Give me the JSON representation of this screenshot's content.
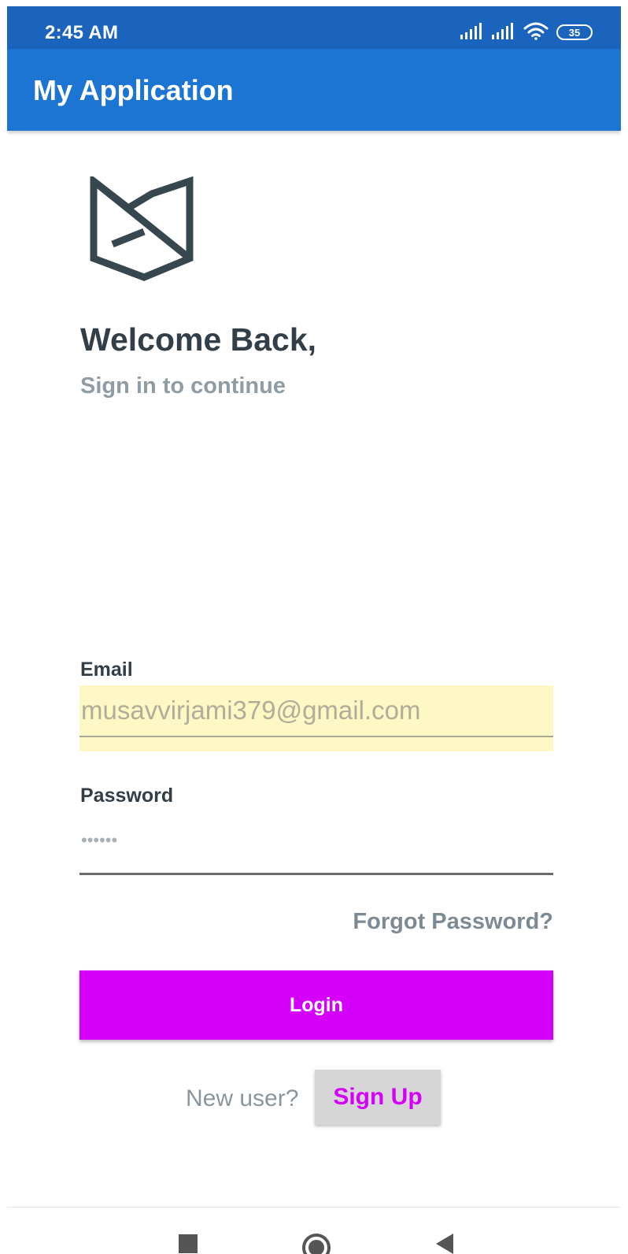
{
  "status_bar": {
    "time": "2:45 AM",
    "battery": "35",
    "icons": [
      "signal-icon",
      "signal-icon",
      "wifi-icon",
      "battery-icon"
    ]
  },
  "app_bar": {
    "title": "My Application"
  },
  "logo": {
    "icon": "fox-logo-icon",
    "color": "#37474f"
  },
  "header": {
    "welcome": "Welcome Back,",
    "subtitle": "Sign in to continue"
  },
  "form": {
    "email_label": "Email",
    "email_value": "musavvirjami379@gmail.com",
    "password_label": "Password",
    "password_value": "••••••",
    "forgot_password": "Forgot Password?",
    "login_label": "Login",
    "new_user_text": "New user?",
    "signup_label": "Sign Up"
  },
  "colors": {
    "status_bar": "#1a64be",
    "app_bar": "#1c75d2",
    "accent": "#d500f9",
    "autofill_bg": "#fdf8c4"
  },
  "nav_bar": {
    "icons": [
      "recents-square-icon",
      "home-circle-icon",
      "back-triangle-icon"
    ]
  }
}
